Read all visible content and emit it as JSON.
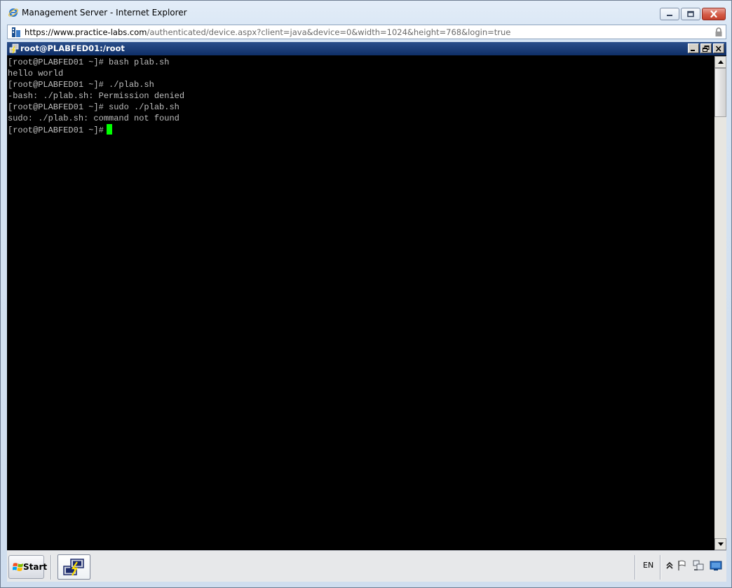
{
  "window": {
    "title": "Management Server - Internet Explorer"
  },
  "address_bar": {
    "protocol": "https://",
    "host": "www.practice-labs.com",
    "path": "/authenticated/device.aspx?client=java&device=0&width=1024&height=768&login=true"
  },
  "putty": {
    "title": "root@PLABFED01:/root"
  },
  "terminal": {
    "lines": [
      "[root@PLABFED01 ~]# bash plab.sh",
      "hello world",
      "[root@PLABFED01 ~]# ./plab.sh",
      "-bash: ./plab.sh: Permission denied",
      "[root@PLABFED01 ~]# sudo ./plab.sh",
      "sudo: ./plab.sh: command not found"
    ],
    "prompt": "[root@PLABFED01 ~]#"
  },
  "taskbar": {
    "start_label": "Start",
    "language": "EN"
  },
  "colors": {
    "terminal_bg": "#000000",
    "terminal_fg": "#bfbfbf",
    "cursor": "#00ff00",
    "putty_title_bg": "#0f2f67"
  },
  "icons": {
    "ie": "internet-explorer-icon",
    "site": "site-icon",
    "lock": "lock-icon",
    "putty": "putty-icon",
    "start": "windows-logo-icon",
    "task_app": "putty-task-icon",
    "tray_up": "chevron-up-icon",
    "tray_flag": "flag-icon",
    "tray_network": "network-icon",
    "tray_desktop": "desktop-icon"
  }
}
